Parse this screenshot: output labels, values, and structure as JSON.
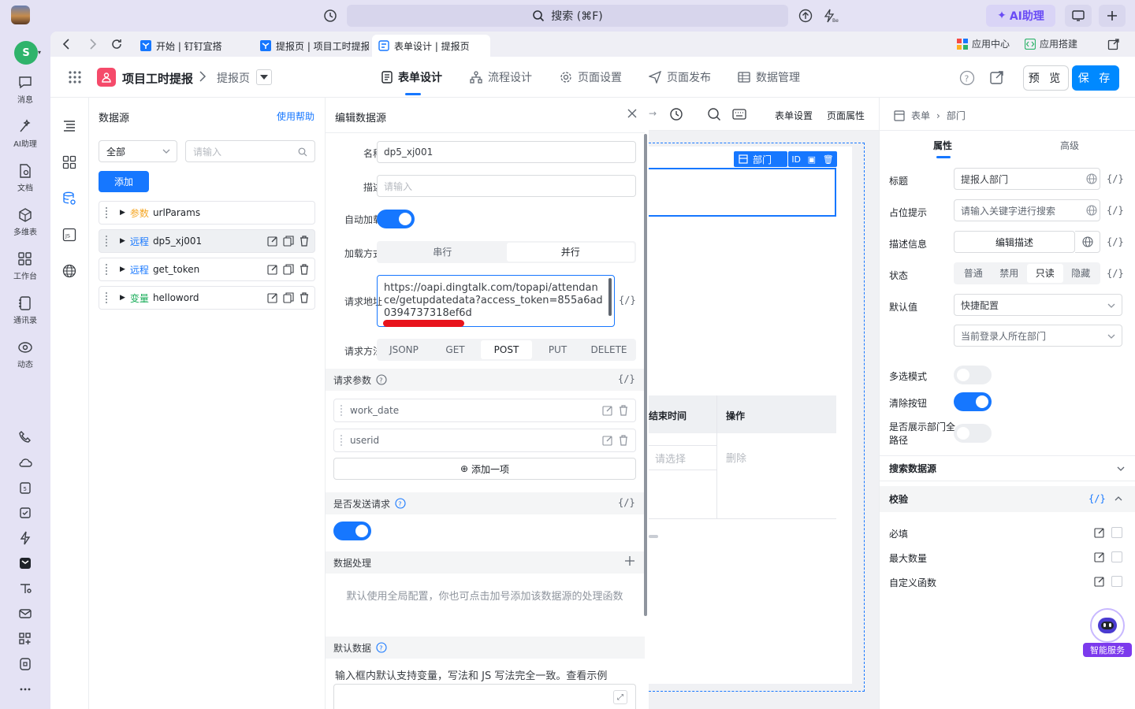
{
  "topbar": {
    "search": "搜索 (⌘F)",
    "ai_assistant": "AI助理"
  },
  "rail": {
    "items": [
      {
        "label": "消息",
        "icon": "message-icon"
      },
      {
        "label": "AI助理",
        "icon": "ai-sparkle-icon"
      },
      {
        "label": "文档",
        "icon": "document-icon"
      },
      {
        "label": "多维表",
        "icon": "multitable-icon"
      },
      {
        "label": "工作台",
        "icon": "workbench-icon"
      },
      {
        "label": "通讯录",
        "icon": "contacts-icon"
      },
      {
        "label": "动态",
        "icon": "moments-icon"
      }
    ]
  },
  "browser": {
    "tabs": [
      {
        "label": "开始 | 钉钉宜搭"
      },
      {
        "label": "提报页 | 项目工时提报"
      },
      {
        "label": "表单设计 | 提报页"
      }
    ],
    "right_links": [
      "应用中心",
      "应用搭建"
    ]
  },
  "header": {
    "app_name": "项目工时提报",
    "page_name": "提报页",
    "nav": [
      "表单设计",
      "流程设计",
      "页面设置",
      "页面发布",
      "数据管理"
    ],
    "preview": "预 览",
    "save": "保 存"
  },
  "datasource": {
    "title": "数据源",
    "help": "使用帮助",
    "filter": "全部",
    "search_placeholder": "请输入",
    "add": "添加",
    "items": [
      {
        "tag": "参数",
        "name": "urlParams",
        "color": "#f5a623"
      },
      {
        "tag": "远程",
        "name": "dp5_xj001",
        "color": "#1677ff"
      },
      {
        "tag": "远程",
        "name": "get_token",
        "color": "#1677ff"
      },
      {
        "tag": "变量",
        "name": "helloword",
        "color": "#1aad5a"
      }
    ]
  },
  "editor": {
    "title": "编辑数据源",
    "name_label": "名称",
    "name_value": "dp5_xj001",
    "desc_label": "描述",
    "desc_placeholder": "请输入",
    "autoload_label": "自动加载",
    "loadmode_label": "加载方式",
    "loadmode_options": [
      "串行",
      "并行"
    ],
    "url_label": "请求地址",
    "url_value": "https://oapi.dingtalk.com/topapi/attendance/getupdatedata?access_token=855a6ad0394737318ef6d",
    "method_label": "请求方法",
    "methods": [
      "JSONP",
      "GET",
      "POST",
      "PUT",
      "DELETE"
    ],
    "params_label": "请求参数",
    "params": [
      "work_date",
      "userid"
    ],
    "add_item": "添加一项",
    "send_label": "是否发送请求",
    "processing_label": "数据处理",
    "processing_hint": "默认使用全局配置，你也可点击加号添加该数据源的处理函数",
    "default_label": "默认数据",
    "default_hint": "输入框内默认支持变量，写法和 JS 写法完全一致。查看示例",
    "braces": "{/}"
  },
  "canvas": {
    "toolbar": [
      "表单设置",
      "页面属性"
    ],
    "selected_label": "部门",
    "id_badge": "ID",
    "table_cols": [
      "结束时间",
      "操作"
    ],
    "table_placeholder": "请选择",
    "table_delete": "删除"
  },
  "props": {
    "crumb": [
      "表单",
      "部门"
    ],
    "tabs": [
      "属性",
      "高级"
    ],
    "title_label": "标题",
    "title_value": "提报人部门",
    "placeholder_label": "占位提示",
    "placeholder_value": "请输入关键字进行搜索",
    "desc_label": "描述信息",
    "desc_button": "编辑描述",
    "state_label": "状态",
    "states": [
      "普通",
      "禁用",
      "只读",
      "隐藏"
    ],
    "default_label": "默认值",
    "default_mode": "快捷配置",
    "default_value": "当前登录人所在部门",
    "multi_label": "多选模式",
    "clear_label": "清除按钮",
    "fullpath_label": "是否展示部门全路径",
    "search_source": "搜索数据源",
    "validate": "校验",
    "rules": [
      "必填",
      "最大数量",
      "自定义函数"
    ],
    "smart_service": "智能服务"
  }
}
